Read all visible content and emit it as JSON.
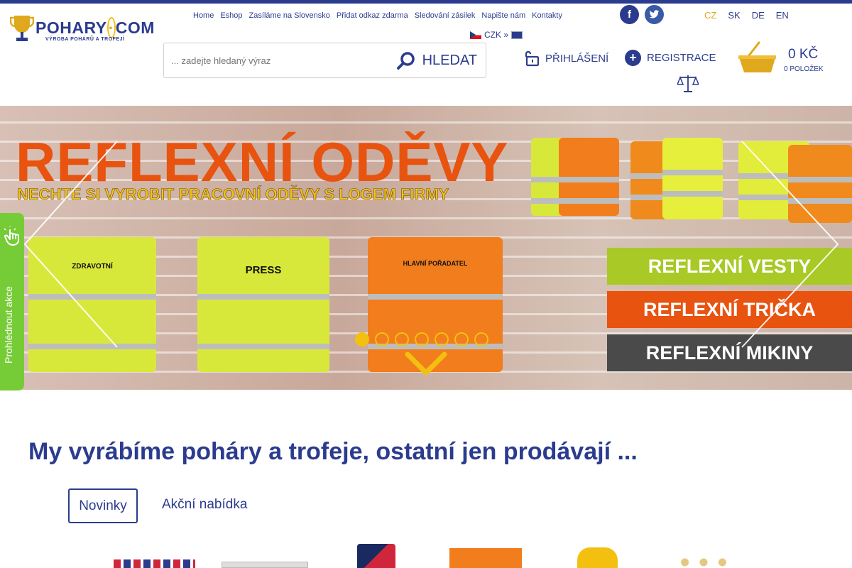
{
  "brand": {
    "logo_main": "POHARY",
    "logo_dot": "·",
    "logo_tld": "COM",
    "logo_tagline": "VÝROBA POHÁRŮ A TROFEJÍ"
  },
  "nav": [
    "Home",
    "Eshop",
    "Zasíláme na Slovensko",
    "Přidat odkaz zdarma",
    "Sledování zásilek",
    "Napište nám",
    "Kontakty"
  ],
  "social": {
    "facebook": "f",
    "twitter": "t"
  },
  "languages": [
    {
      "code": "CZ",
      "active": true
    },
    {
      "code": "SK",
      "active": false
    },
    {
      "code": "DE",
      "active": false
    },
    {
      "code": "EN",
      "active": false
    }
  ],
  "currency": {
    "label": "CZK »"
  },
  "search": {
    "placeholder": "... zadejte hledaný výraz",
    "button_label": "HLEDAT"
  },
  "account": {
    "login_label": "PŘIHLÁŠENÍ",
    "register_label": "REGISTRACE"
  },
  "cart": {
    "total": "0 KČ",
    "items": "0 POLOŽEK"
  },
  "banner": {
    "title": "REFLEXNÍ ODĚVY",
    "subtitle": "NECHTE SI VYROBIT PRACOVNÍ ODĚVY S LOGEM FIRMY",
    "strips": [
      "REFLEXNÍ VESTY",
      "REFLEXNÍ TRIČKA",
      "REFLEXNÍ MIKINY"
    ],
    "vest_labels": [
      "ZDRAVOTNÍ",
      "PRESS",
      "HLAVNÍ POŘADATEL"
    ],
    "slide_count": 7,
    "active_slide": 1
  },
  "side_tab": {
    "label": "Prohlédnout akce"
  },
  "headline": "My vyrábíme poháry a trofeje, ostatní jen prodávají ...",
  "tabs": {
    "new_label": "Novinky",
    "sale_label": "Akční nabídka"
  },
  "colors": {
    "brand_blue": "#2b3c8e",
    "accent_gold": "#e0a81c",
    "green": "#76cc36",
    "orange": "#e8530f"
  }
}
